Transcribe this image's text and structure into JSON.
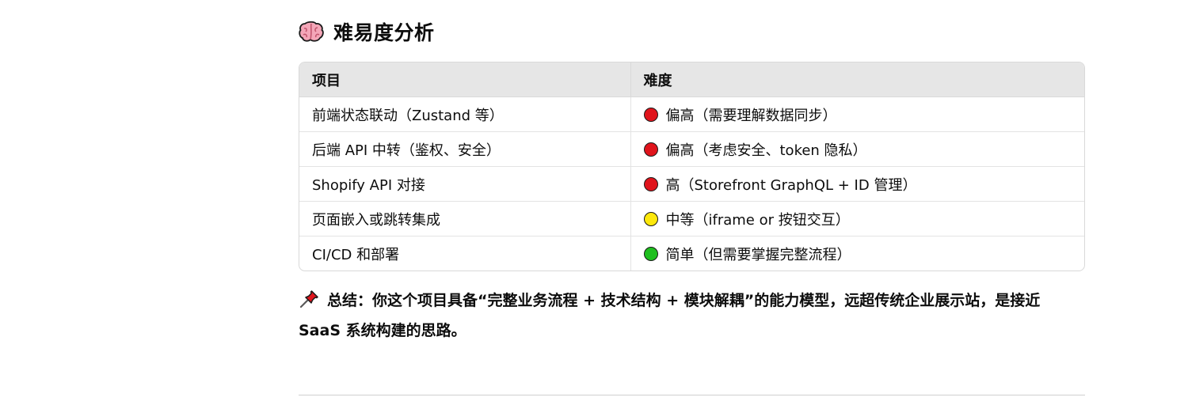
{
  "section": {
    "emoji_icon": "brain-icon",
    "title": "难易度分析"
  },
  "table": {
    "headers": [
      "项目",
      "难度"
    ],
    "rows": [
      {
        "item": "前端状态联动（Zustand 等）",
        "level_color": "#e0141c",
        "level": "偏高（需要理解数据同步）"
      },
      {
        "item": "后端 API 中转（鉴权、安全）",
        "level_color": "#e0141c",
        "level": "偏高（考虑安全、token 隐私）"
      },
      {
        "item": "Shopify API 对接",
        "level_color": "#e0141c",
        "level": "高（Storefront GraphQL + ID 管理）"
      },
      {
        "item": "页面嵌入或跳转集成",
        "level_color": "#fde80b",
        "level": "中等（iframe or 按钮交互）"
      },
      {
        "item": "CI/CD 和部署",
        "level_color": "#1fbf1f",
        "level": "简单（但需要掌握完整流程）"
      }
    ]
  },
  "summary": {
    "icon": "pushpin-icon",
    "text": "总结：你这个项目具备“完整业务流程 + 技术结构 + 模块解耦”的能力模型，远超传统企业展示站，是接近 SaaS 系统构建的思路。"
  }
}
